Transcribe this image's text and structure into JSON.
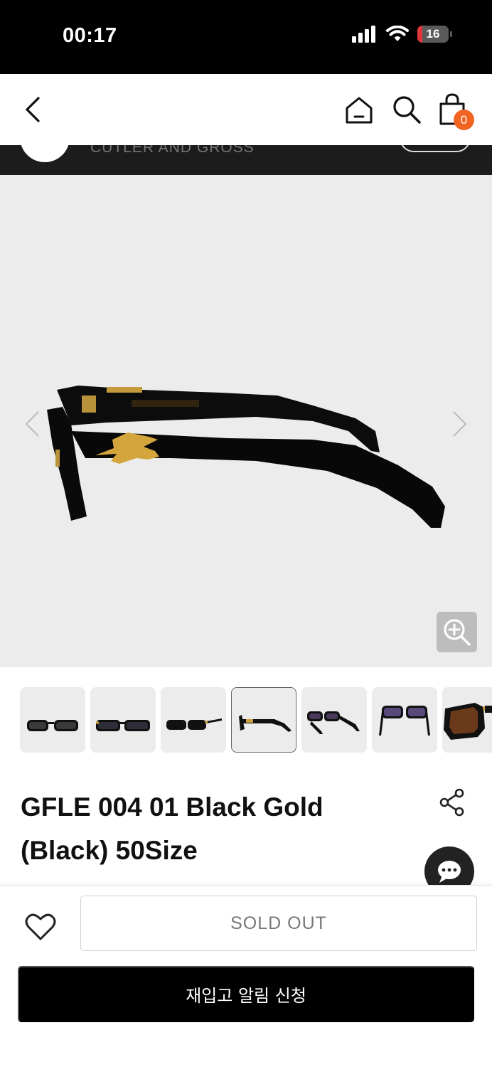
{
  "status_bar": {
    "time": "00:17",
    "battery_level": "16",
    "battery_color": "#e4353b"
  },
  "nav": {
    "back_icon": "chevron-left-icon",
    "home_icon": "home-icon",
    "search_icon": "search-icon",
    "cart_icon": "shopping-bag-icon",
    "cart_count": "0",
    "badge_color": "#f26422"
  },
  "brand": {
    "name": "CUTLER AND GROSS"
  },
  "gallery": {
    "prev_icon": "chevron-left-icon",
    "next_icon": "chevron-right-icon",
    "zoom_icon": "zoom-in-icon",
    "thumbnail_count": 7,
    "active_index": 3
  },
  "product": {
    "title": "GFLE 004 01 Black Gold (Black) 50Size",
    "share_icon": "share-icon",
    "chat_icon": "chat-bubble-icon"
  },
  "actions": {
    "wishlist_icon": "heart-icon",
    "sold_out_label": "SOLD OUT",
    "restock_label": "재입고 알림 신청"
  }
}
